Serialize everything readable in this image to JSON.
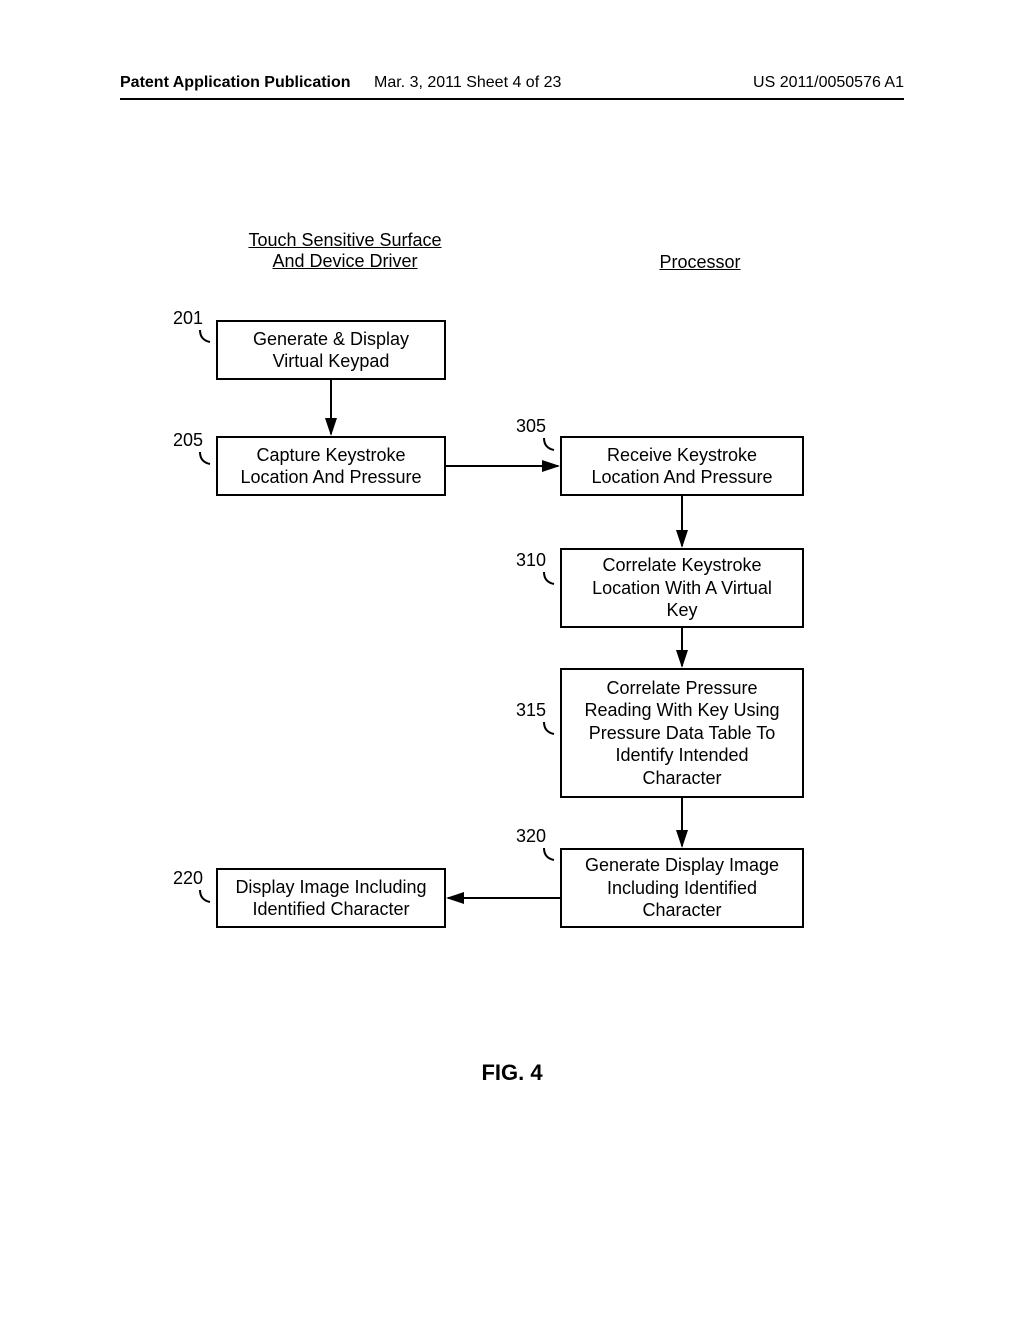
{
  "header": {
    "left": "Patent Application Publication",
    "mid": "Mar. 3, 2011  Sheet 4 of 23",
    "right": "US 2011/0050576 A1"
  },
  "columns": {
    "left_title": "Touch Sensitive Surface\nAnd Device Driver",
    "right_title": "Processor"
  },
  "boxes": {
    "b201": "Generate & Display\nVirtual Keypad",
    "b205": "Capture Keystroke\nLocation And Pressure",
    "b220": "Display Image Including\nIdentified Character",
    "b305": "Receive Keystroke\nLocation And Pressure",
    "b310": "Correlate Keystroke\nLocation With A Virtual\nKey",
    "b315": "Correlate Pressure\nReading With Key Using\nPressure Data Table To\nIdentify Intended\nCharacter",
    "b320": "Generate Display Image\nIncluding Identified\nCharacter"
  },
  "refs": {
    "r201": "201",
    "r205": "205",
    "r220": "220",
    "r305": "305",
    "r310": "310",
    "r315": "315",
    "r320": "320"
  },
  "figure_caption": "FIG. 4"
}
